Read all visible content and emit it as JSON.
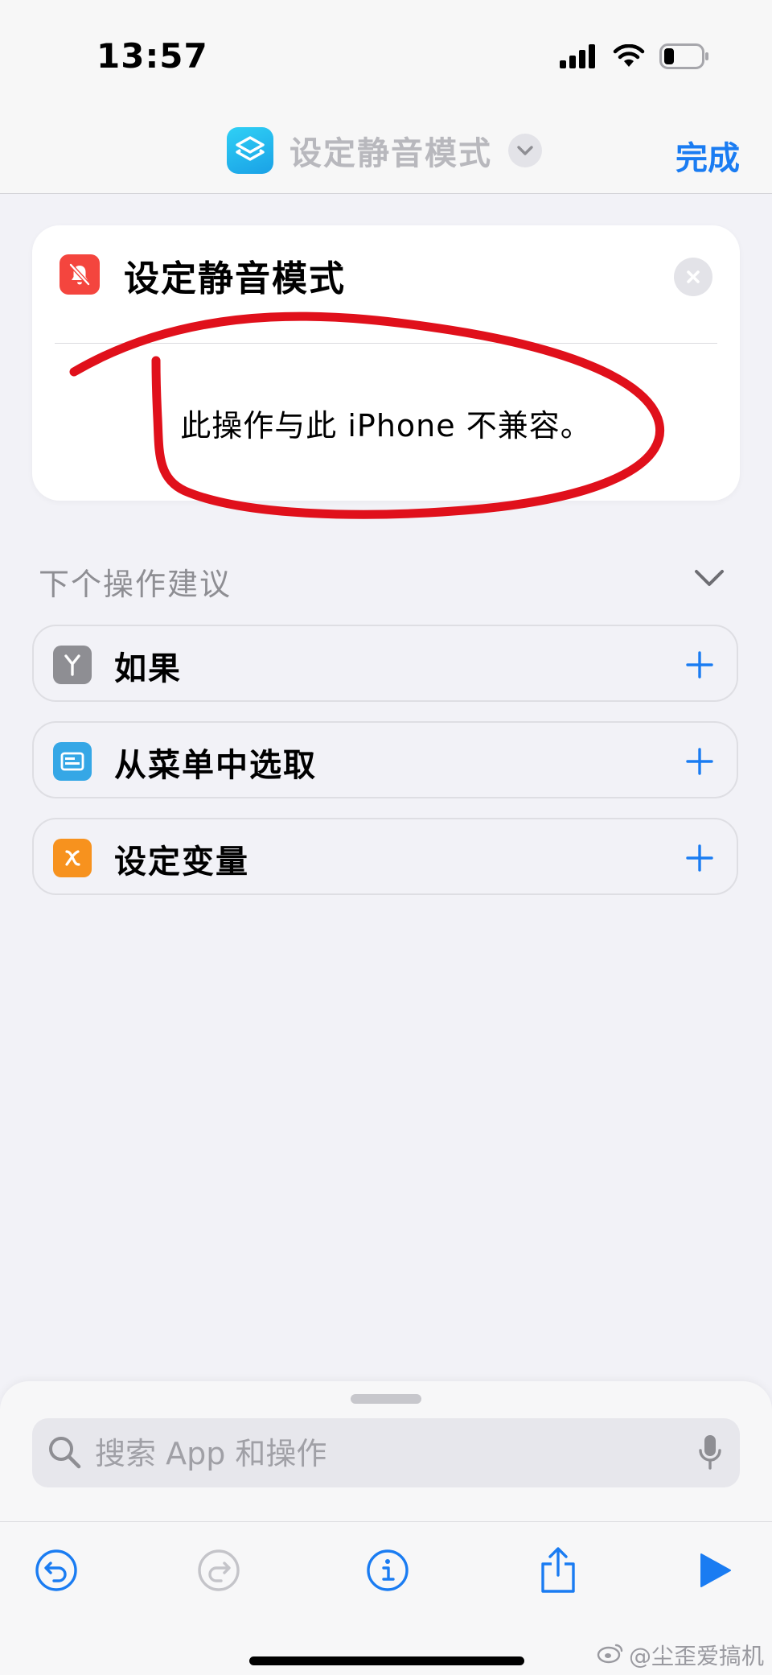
{
  "status_bar": {
    "time": "13:57",
    "icons": [
      "cellular-signal-icon",
      "wifi-icon",
      "battery-icon"
    ]
  },
  "nav": {
    "title": "设定静音模式",
    "done_label": "完成",
    "app_icon": "shortcuts-app-icon",
    "accent_color": "#1a7cf2"
  },
  "action_card": {
    "title": "设定静音模式",
    "icon": "bell-slash-icon",
    "icon_color": "#f4453e",
    "message": "此操作与此 iPhone 不兼容。",
    "annotation_color": "#e0101b"
  },
  "suggestions": {
    "header": "下个操作建议",
    "items": [
      {
        "label": "如果",
        "icon": "branch-icon",
        "color": "#8e8e93"
      },
      {
        "label": "从菜单中选取",
        "icon": "menu-card-icon",
        "color": "#35a7e6"
      },
      {
        "label": "设定变量",
        "icon": "variable-x-icon",
        "color": "#f7921e"
      }
    ]
  },
  "search": {
    "placeholder": "搜索 App 和操作",
    "value": ""
  },
  "toolbar": {
    "buttons": [
      "undo-icon",
      "redo-icon",
      "info-icon",
      "share-icon",
      "play-icon"
    ]
  },
  "watermark": {
    "text": "@尘歪爱搞机"
  }
}
